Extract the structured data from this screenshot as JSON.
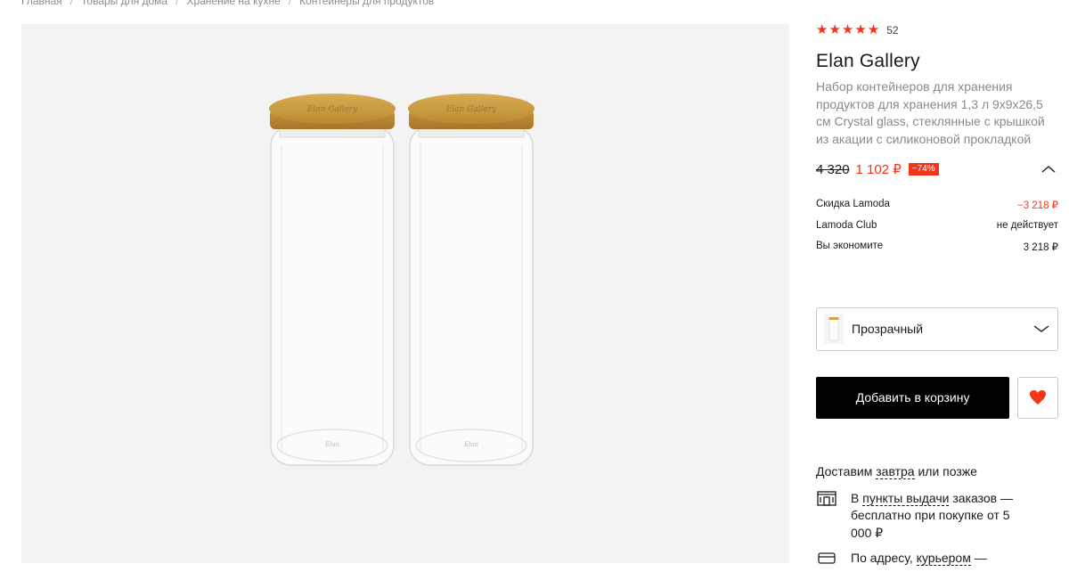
{
  "breadcrumb": {
    "items": [
      "Главная",
      "Товары для дома",
      "Хранение на кухне",
      "Контейнеры для продуктов"
    ],
    "separator": "/"
  },
  "product": {
    "rating_stars": "★★★★★",
    "rating_count": "52",
    "brand": "Elan Gallery",
    "name": "Набор контейнеров для хранения продуктов для хранения 1,3 л 9x9x26,5 см Crystal glass, стеклянные с крышкой из акации с силиконовой прокладкой",
    "old_price": "4 320",
    "new_price": "1 102 ₽",
    "discount_badge": "−74%"
  },
  "price_details": [
    {
      "label": "Скидка Lamoda",
      "value": "−3 218 ₽",
      "highlight": true
    },
    {
      "label": "Lamoda Club",
      "value": "не действует",
      "highlight": false
    },
    {
      "label": "Вы экономите",
      "value": "3 218 ₽",
      "highlight": false
    }
  ],
  "color_select": {
    "selected": "Прозрачный",
    "icon": "chevron-down-icon"
  },
  "actions": {
    "add_to_cart": "Добавить в корзину",
    "wishlist_icon": "heart-icon"
  },
  "delivery": {
    "title_prefix": "Доставим ",
    "title_link": "завтра",
    "title_suffix": " или позже",
    "pickup": {
      "prefix": "В ",
      "link": "пункты выдачи",
      "suffix": " заказов — бесплатно при покупке от 5 000 ₽",
      "icon": "pickup-point-icon"
    },
    "courier": {
      "prefix": "По адресу, ",
      "link": "курьером",
      "suffix": " —",
      "icon": "courier-icon"
    }
  },
  "colors": {
    "accent": "#f4351a",
    "button_bg": "#000000",
    "gallery_bg": "#f3f3f3",
    "lid": "#d2a24a"
  }
}
